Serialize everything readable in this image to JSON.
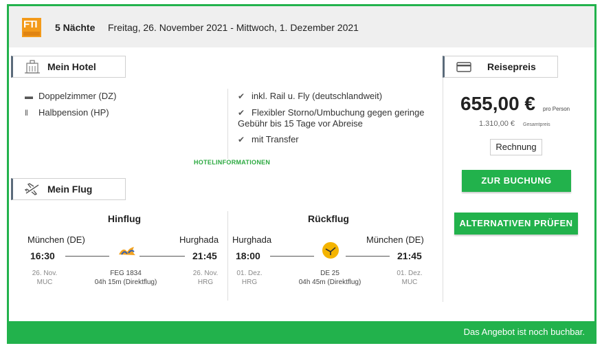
{
  "header": {
    "nights": "5 Nächte",
    "dates": "Freitag, 26. November 2021 - Mittwoch, 1. Dezember 2021",
    "logo_text": "FTI",
    "brand_color": "#f39a1a"
  },
  "hotel": {
    "tab_label": "Mein Hotel",
    "room": "Doppelzimmer (DZ)",
    "board": "Halbpension (HP)",
    "features": [
      "inkl. Rail u. Fly (deutschlandweit)",
      "Flexibler Storno/Umbuchung gegen geringe Gebühr bis 15 Tage vor Abreise",
      "mit Transfer"
    ],
    "info_link": "HOTELINFORMATIONEN"
  },
  "price": {
    "tab_label": "Reisepreis",
    "per_person": "655,00 €",
    "per_person_label": "pro Person",
    "total": "1.310,00 €",
    "total_label": "Gesamtpreis",
    "invoice_button": "Rechnung",
    "book_button": "ZUR BUCHUNG",
    "alternatives_button": "ALTERNATIVEN PRÜFEN"
  },
  "flight": {
    "tab_label": "Mein Flug",
    "outbound": {
      "title": "Hinflug",
      "from_city": "München (DE)",
      "to_city": "Hurghada",
      "dep_time": "16:30",
      "arr_time": "21:45",
      "dep_date": "26. Nov.",
      "dep_code": "MUC",
      "arr_date": "26. Nov.",
      "arr_code": "HRG",
      "flight_no": "FEG 1834",
      "duration": "04h 15m (Direktflug)"
    },
    "return": {
      "title": "Rückflug",
      "from_city": "Hurghada",
      "to_city": "München (DE)",
      "dep_time": "18:00",
      "arr_time": "21:45",
      "dep_date": "01. Dez.",
      "dep_code": "HRG",
      "arr_date": "01. Dez.",
      "arr_code": "MUC",
      "flight_no": "DE 25",
      "duration": "04h 45m (Direktflug)"
    }
  },
  "footer": {
    "status": "Das Angebot ist noch buchbar."
  },
  "colors": {
    "accent": "#22b24c",
    "header_bg": "#efefef"
  }
}
